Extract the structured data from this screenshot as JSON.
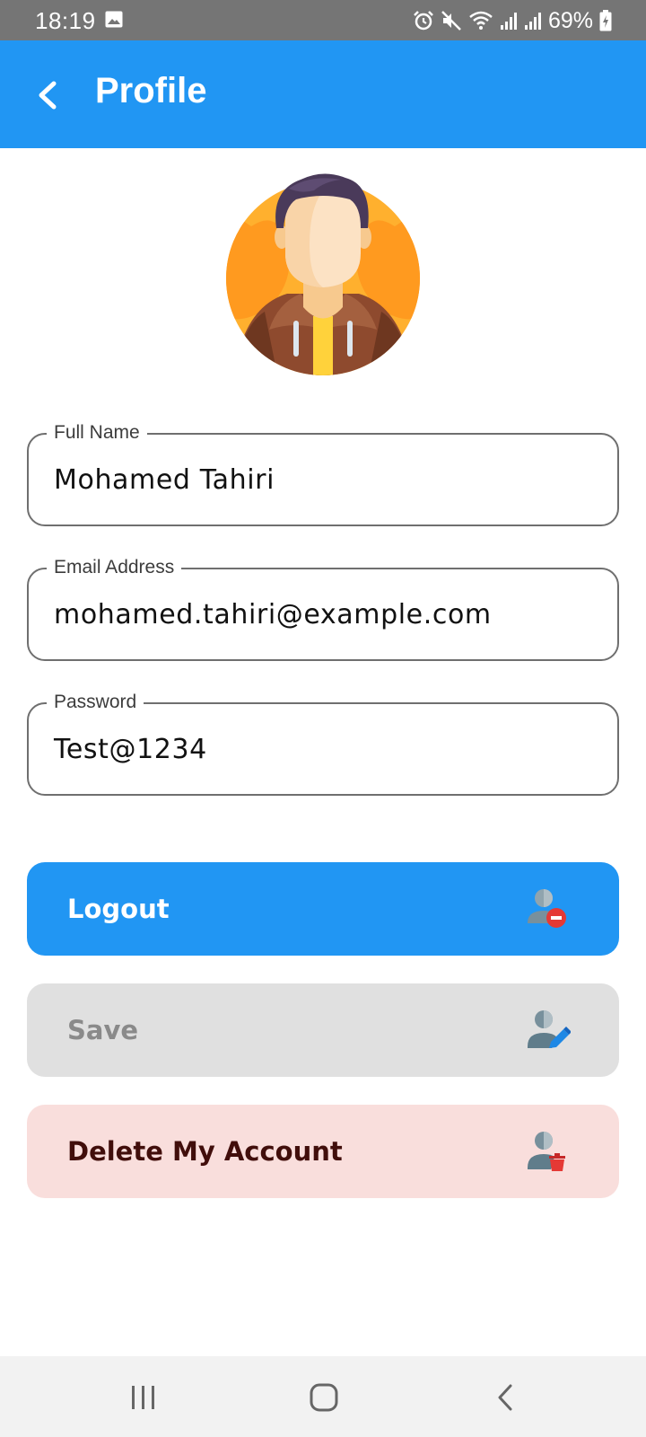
{
  "status_bar": {
    "time": "18:19",
    "battery": "69%",
    "icons": [
      "image-icon",
      "alarm-icon",
      "mute-icon",
      "wifi-icon",
      "signal-icon",
      "signal-icon-2",
      "battery-charging-icon"
    ]
  },
  "app_bar": {
    "title": "Profile",
    "back_icon": "chevron-left-icon",
    "color": "#2196F3"
  },
  "avatar": {
    "icon": "user-avatar-illustration"
  },
  "form": {
    "full_name": {
      "label": "Full Name",
      "value": "Mohamed Tahiri"
    },
    "email": {
      "label": "Email Address",
      "value": "mohamed.tahiri@example.com"
    },
    "password": {
      "label": "Password",
      "value": "Test@1234"
    }
  },
  "actions": {
    "logout": {
      "label": "Logout",
      "icon": "user-remove-icon",
      "color": "#2196F3"
    },
    "save": {
      "label": "Save",
      "icon": "user-edit-icon",
      "color": "#E0E0E0"
    },
    "delete": {
      "label": "Delete My Account",
      "icon": "user-delete-icon",
      "color": "#F9DEDC"
    }
  },
  "nav_bar": {
    "icons": [
      "recents-icon",
      "home-icon",
      "back-icon"
    ]
  }
}
